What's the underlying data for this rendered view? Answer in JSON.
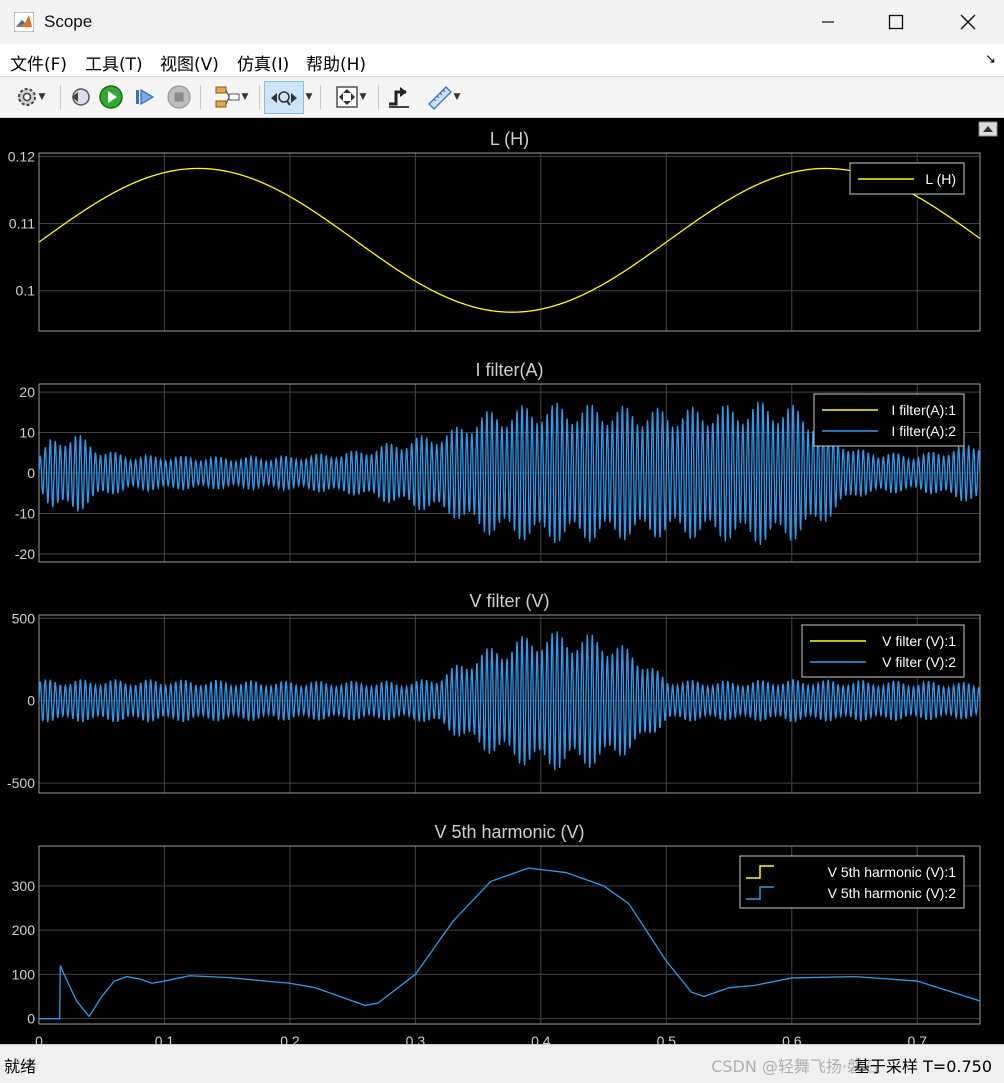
{
  "window": {
    "title": "Scope"
  },
  "menu": {
    "items": [
      "文件(F)",
      "工具(T)",
      "视图(V)",
      "仿真(I)",
      "帮助(H)"
    ]
  },
  "toolbar": {
    "icons": [
      "gear-icon",
      "step-back-icon",
      "run-icon",
      "step-forward-icon",
      "stop-icon",
      "signal-select-icon",
      "zoom-time-icon",
      "fit-to-view-icon",
      "triggers-icon",
      "measurements-icon"
    ]
  },
  "colors": {
    "series1": "#ffff00",
    "series2": "#2b9cf0",
    "grid": "#444444",
    "axis_text": "#d0d0d0",
    "plot_bg": "#000000"
  },
  "status": {
    "left": "就绪",
    "right": "基于采样  T=0.750",
    "watermark": "CSDN @轻舞飞扬·磐石"
  },
  "chart_data": [
    {
      "type": "line",
      "title": "L (H)",
      "xlim": [
        0,
        0.75
      ],
      "ylim": [
        0.094,
        0.1205
      ],
      "yticks": [
        0.1,
        0.11,
        0.12
      ],
      "ytick_labels": [
        "0.1",
        "0.11",
        "0.12"
      ],
      "xticks": [
        0,
        0.1,
        0.2,
        0.3,
        0.4,
        0.5,
        0.6,
        0.7
      ],
      "grid": true,
      "legend_position": "top-right",
      "series": [
        {
          "name": "L (H)",
          "color": "#ffff00",
          "model": "sine",
          "mean": 0.1075,
          "amplitude": 0.0107,
          "frequency_hz": 2,
          "phase": 0.127
        }
      ]
    },
    {
      "type": "line",
      "title": "I filter(A)",
      "xlim": [
        0,
        0.75
      ],
      "ylim": [
        -22,
        22
      ],
      "yticks": [
        -20,
        -10,
        0,
        10,
        20
      ],
      "ytick_labels": [
        "-20",
        "-10",
        "0",
        "10",
        "20"
      ],
      "xticks": [
        0,
        0.1,
        0.2,
        0.3,
        0.4,
        0.5,
        0.6,
        0.7
      ],
      "grid": true,
      "legend_position": "top-right",
      "series": [
        {
          "name": "I filter(A):1",
          "color": "#ffff00"
        },
        {
          "name": "I filter(A):2",
          "color": "#2b9cf0",
          "model": "am-oscillation",
          "carrier_hz": 250,
          "envelope_t": [
            0,
            0.01,
            0.03,
            0.05,
            0.07,
            0.15,
            0.2,
            0.25,
            0.3,
            0.33,
            0.35,
            0.4,
            0.45,
            0.5,
            0.55,
            0.58,
            0.6,
            0.62,
            0.65,
            0.7,
            0.75
          ],
          "envelope_a": [
            4,
            9,
            10,
            6,
            4.5,
            4,
            4.2,
            5.5,
            9,
            11,
            15,
            17.5,
            17,
            16,
            17,
            18,
            17,
            14,
            6,
            4.5,
            8
          ]
        }
      ]
    },
    {
      "type": "line",
      "title": "V filter (V)",
      "xlim": [
        0,
        0.75
      ],
      "ylim": [
        -560,
        520
      ],
      "yticks": [
        -500,
        0,
        500
      ],
      "ytick_labels": [
        "-500",
        "0",
        "500"
      ],
      "xticks": [
        0,
        0.1,
        0.2,
        0.3,
        0.4,
        0.5,
        0.6,
        0.7
      ],
      "grid": true,
      "legend_position": "top-right",
      "series": [
        {
          "name": "V filter (V):1",
          "color": "#ffff00"
        },
        {
          "name": "V filter (V):2",
          "color": "#2b9cf0",
          "model": "am-oscillation",
          "carrier_hz": 250,
          "envelope_t": [
            0,
            0.1,
            0.2,
            0.3,
            0.32,
            0.35,
            0.38,
            0.4,
            0.45,
            0.48,
            0.5,
            0.55,
            0.6,
            0.7,
            0.75
          ],
          "envelope_a": [
            130,
            130,
            120,
            120,
            160,
            300,
            380,
            430,
            400,
            280,
            130,
            120,
            130,
            120,
            110
          ]
        }
      ]
    },
    {
      "type": "line",
      "title": "V 5th harmonic (V)",
      "xlim": [
        0,
        0.75
      ],
      "ylim": [
        -12,
        390
      ],
      "yticks": [
        0,
        100,
        200,
        300
      ],
      "ytick_labels": [
        "0",
        "100",
        "200",
        "300"
      ],
      "xticks": [
        0,
        0.1,
        0.2,
        0.3,
        0.4,
        0.5,
        0.6,
        0.7
      ],
      "xtick_labels": [
        "0",
        "0.1",
        "0.2",
        "0.3",
        "0.4",
        "0.5",
        "0.6",
        "0.7"
      ],
      "grid": true,
      "legend_position": "top-right",
      "legend_style": "stairs",
      "series": [
        {
          "name": "V 5th harmonic (V):1",
          "color": "#ffff00"
        },
        {
          "name": "V 5th harmonic (V):2",
          "color": "#2b9cf0",
          "x": [
            0,
            0.0165,
            0.017,
            0.02,
            0.03,
            0.04,
            0.05,
            0.06,
            0.07,
            0.08,
            0.09,
            0.1,
            0.12,
            0.15,
            0.2,
            0.22,
            0.25,
            0.26,
            0.27,
            0.3,
            0.33,
            0.36,
            0.39,
            0.42,
            0.45,
            0.47,
            0.5,
            0.52,
            0.53,
            0.55,
            0.57,
            0.6,
            0.65,
            0.7,
            0.75
          ],
          "y": [
            0,
            0,
            120,
            100,
            40,
            5,
            50,
            85,
            95,
            90,
            80,
            85,
            97,
            93,
            80,
            70,
            40,
            30,
            35,
            100,
            220,
            310,
            340,
            330,
            300,
            260,
            130,
            60,
            50,
            70,
            75,
            92,
            95,
            85,
            40
          ]
        }
      ]
    }
  ]
}
